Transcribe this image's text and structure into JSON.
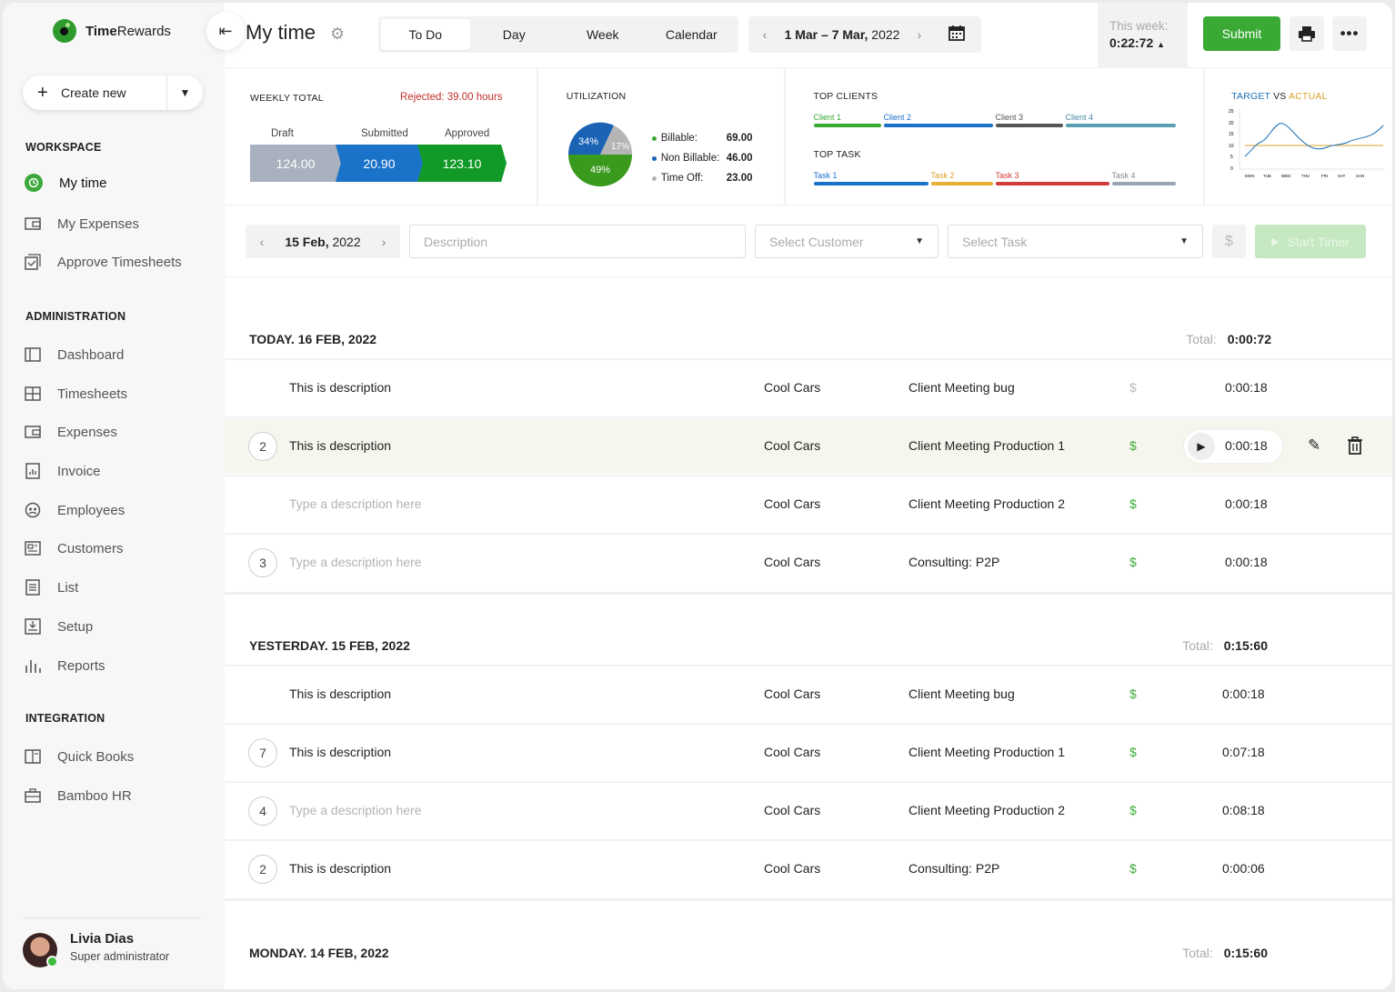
{
  "brand": {
    "name_bold": "Time",
    "name_rest": "Rewards"
  },
  "sidebar": {
    "create_label": "Create new",
    "workspace_title": "WORKSPACE",
    "workspace": [
      {
        "label": "My time"
      },
      {
        "label": "My Expenses"
      },
      {
        "label": "Approve Timesheets"
      }
    ],
    "admin_title": "ADMINISTRATION",
    "admin": [
      {
        "label": "Dashboard"
      },
      {
        "label": "Timesheets"
      },
      {
        "label": "Expenses"
      },
      {
        "label": "Invoice"
      },
      {
        "label": "Employees"
      },
      {
        "label": "Customers"
      },
      {
        "label": "List"
      },
      {
        "label": "Setup"
      },
      {
        "label": "Reports"
      }
    ],
    "integration_title": "INTEGRATION",
    "integration": [
      {
        "label": "Quick Books"
      },
      {
        "label": "Bamboo HR"
      }
    ],
    "user": {
      "name": "Livia Dias",
      "role": "Super administrator"
    }
  },
  "header": {
    "title": "My time",
    "tabs": [
      {
        "label": "To Do"
      },
      {
        "label": "Day"
      },
      {
        "label": "Week"
      },
      {
        "label": "Calendar"
      }
    ],
    "range_bold": "1 Mar – 7 Mar,",
    "range_year": "2022",
    "this_week_label": "This week:",
    "this_week_value": "0:22:72",
    "submit_label": "Submit"
  },
  "weekly": {
    "title": "WEEKLY TOTAL",
    "rejected": "Rejected: 39.00 hours",
    "draft_label": "Draft",
    "submitted_label": "Submitted",
    "approved_label": "Approved",
    "draft": "124.00",
    "submitted": "20.90",
    "approved": "123.10"
  },
  "utilization": {
    "title": "UTILIZATION",
    "pct_billable": "49%",
    "pct_nonbillable": "34%",
    "pct_timeoff": "17%",
    "billable_label": "Billable:",
    "billable": "69.00",
    "nonbillable_label": "Non Billable:",
    "nonbillable": "46.00",
    "timeoff_label": "Time Off:",
    "timeoff": "23.00"
  },
  "top": {
    "clients_title": "TOP CLIENTS",
    "clients": [
      "Client 1",
      "Client 2",
      "Client 3",
      "Client 4"
    ],
    "task_title": "TOP TASK",
    "tasks": [
      "Task 1",
      "Task 2",
      "Task 3",
      "Task 4"
    ]
  },
  "target": {
    "title_a": "TARGET",
    "vs": " VS ",
    "title_b": "ACTUAL",
    "yticks": [
      "25",
      "20",
      "15",
      "10",
      "5",
      "0"
    ],
    "days": [
      "MON",
      "TUE",
      "WED",
      "THU",
      "FRI",
      "SAT",
      "SAN"
    ]
  },
  "entry": {
    "date_bold": "15 Feb,",
    "date_year": "2022",
    "description_placeholder": "Description",
    "customer_placeholder": "Select Customer",
    "task_placeholder": "Select Task",
    "start_label": "Start Timer",
    "dollar": "$"
  },
  "days": [
    {
      "title": "TODAY. 16 FEB, 2022",
      "total_label": "Total:",
      "total": "0:00:72",
      "rows": [
        {
          "count": "",
          "desc": "This is description",
          "ph": false,
          "customer": "Cool Cars",
          "task": "Client Meeting bug",
          "billable": false,
          "time": "0:00:18"
        },
        {
          "count": "2",
          "desc": "This is description",
          "ph": false,
          "customer": "Cool Cars",
          "task": "Client Meeting Production 1",
          "billable": true,
          "time": "0:00:18"
        },
        {
          "count": "",
          "desc": "Type a description here",
          "ph": true,
          "customer": "Cool Cars",
          "task": "Client Meeting Production 2",
          "billable": true,
          "time": "0:00:18"
        },
        {
          "count": "3",
          "desc": "Type a description here",
          "ph": true,
          "customer": "Cool Cars",
          "task": "Consulting: P2P",
          "billable": true,
          "time": "0:00:18"
        }
      ]
    },
    {
      "title": "YESTERDAY. 15 FEB, 2022",
      "total_label": "Total:",
      "total": "0:15:60",
      "rows": [
        {
          "count": "",
          "desc": "This is description",
          "ph": false,
          "customer": "Cool Cars",
          "task": "Client Meeting bug",
          "billable": true,
          "time": "0:00:18"
        },
        {
          "count": "7",
          "desc": "This is description",
          "ph": false,
          "customer": "Cool Cars",
          "task": "Client Meeting Production 1",
          "billable": true,
          "time": "0:07:18"
        },
        {
          "count": "4",
          "desc": "Type a description here",
          "ph": true,
          "customer": "Cool Cars",
          "task": "Client Meeting Production 2",
          "billable": true,
          "time": "0:08:18"
        },
        {
          "count": "2",
          "desc": "This is description",
          "ph": false,
          "customer": "Cool Cars",
          "task": "Consulting: P2P",
          "billable": true,
          "time": "0:00:06"
        }
      ]
    },
    {
      "title": "MONDAY. 14 FEB, 2022",
      "total_label": "Total:",
      "total": "0:15:60",
      "rows": []
    }
  ],
  "dollar_sign": "$",
  "colors": {
    "accent": "#3aaa35",
    "submitted": "#1a72c9",
    "draft": "#a9b1bf",
    "rejected": "#c0302b",
    "actual": "#1a6fb5",
    "target": "#d9a22c"
  }
}
